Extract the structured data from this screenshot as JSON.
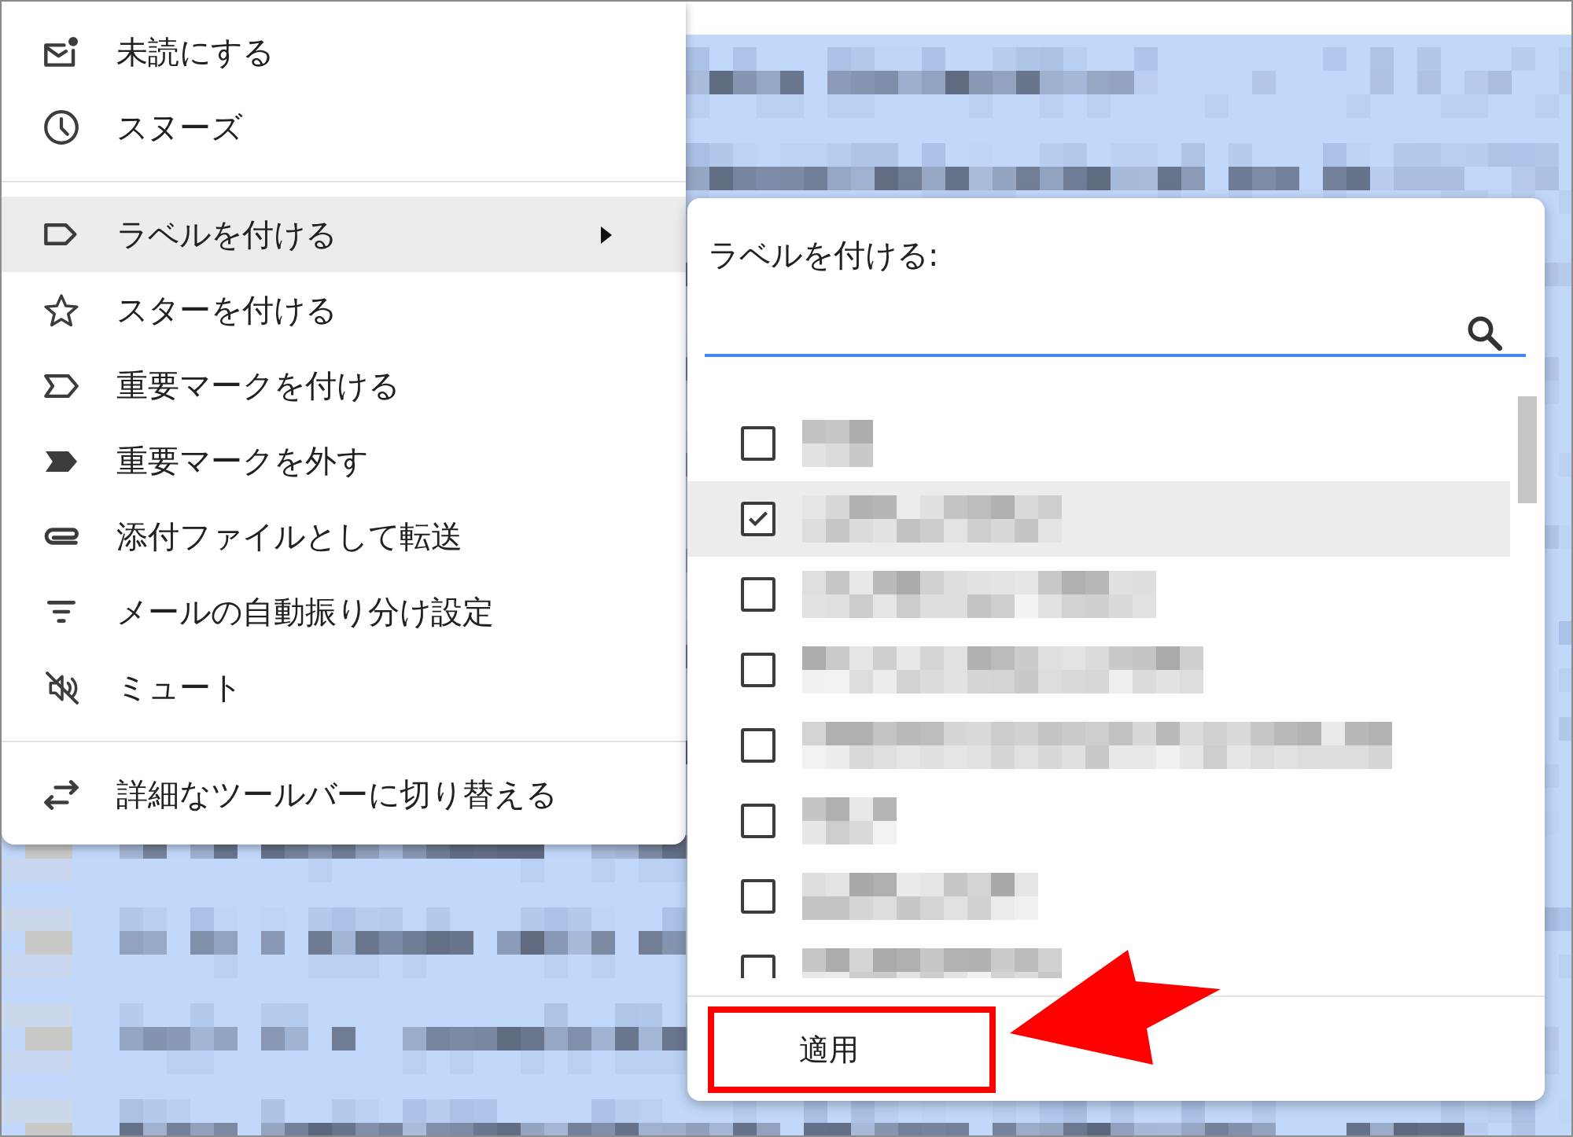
{
  "context_menu": {
    "sections": [
      {
        "items": [
          {
            "label": "未読にする",
            "highlighted": false,
            "has_submenu": false
          },
          {
            "label": "スヌーズ",
            "highlighted": false,
            "has_submenu": false
          }
        ]
      },
      {
        "items": [
          {
            "label": "ラベルを付ける",
            "highlighted": true,
            "has_submenu": true
          },
          {
            "label": "スターを付ける",
            "highlighted": false,
            "has_submenu": false
          },
          {
            "label": "重要マークを付ける",
            "highlighted": false,
            "has_submenu": false
          },
          {
            "label": "重要マークを外す",
            "highlighted": false,
            "has_submenu": false
          },
          {
            "label": "添付ファイルとして転送",
            "highlighted": false,
            "has_submenu": false
          },
          {
            "label": "メールの自動振り分け設定",
            "highlighted": false,
            "has_submenu": false
          },
          {
            "label": "ミュート",
            "highlighted": false,
            "has_submenu": false
          }
        ]
      },
      {
        "items": [
          {
            "label": "詳細なツールバーに切り替える",
            "highlighted": false,
            "has_submenu": false
          }
        ]
      }
    ]
  },
  "label_panel": {
    "title": "ラベルを付ける:",
    "search": {
      "focused": true
    },
    "labels": [
      {
        "checked": false,
        "highlighted": false
      },
      {
        "checked": true,
        "highlighted": true
      },
      {
        "checked": false,
        "highlighted": false
      },
      {
        "checked": false,
        "highlighted": false
      },
      {
        "checked": false,
        "highlighted": false
      },
      {
        "checked": false,
        "highlighted": false
      },
      {
        "checked": false,
        "highlighted": false
      },
      {
        "checked": false,
        "highlighted": false
      }
    ],
    "apply_button": {
      "label": "適用",
      "annotated": true
    }
  }
}
